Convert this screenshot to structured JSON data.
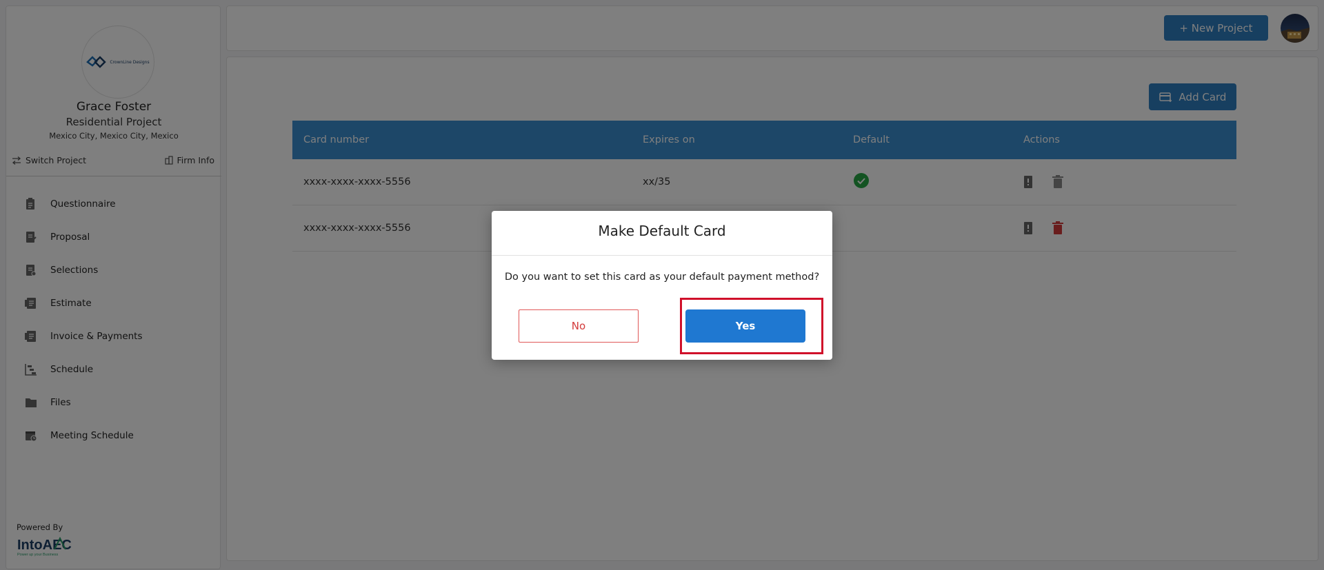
{
  "sidebar": {
    "logo_text": "CrownLine Designs",
    "client_name": "Grace Foster",
    "project_name": "Residential Project",
    "location": "Mexico City, Mexico City, Mexico",
    "switch_project": "Switch Project",
    "firm_info": "Firm Info",
    "items": [
      {
        "label": "Questionnaire",
        "icon": "questionnaire-icon"
      },
      {
        "label": "Proposal",
        "icon": "proposal-icon"
      },
      {
        "label": "Selections",
        "icon": "selections-icon"
      },
      {
        "label": "Estimate",
        "icon": "estimate-icon"
      },
      {
        "label": "Invoice & Payments",
        "icon": "invoice-icon"
      },
      {
        "label": "Schedule",
        "icon": "schedule-icon"
      },
      {
        "label": "Files",
        "icon": "folder-icon"
      },
      {
        "label": "Meeting Schedule",
        "icon": "calendar-icon"
      }
    ],
    "powered_by": "Powered By",
    "powered_logo": "IntoAEC",
    "powered_tagline": "Power up your Business"
  },
  "header": {
    "new_project_label": "+ New Project"
  },
  "main": {
    "add_card_label": "Add Card",
    "table": {
      "columns": [
        "Card number",
        "Expires on",
        "Default",
        "Actions"
      ],
      "rows": [
        {
          "card_number": "xxxx-xxxx-xxxx-5556",
          "expires": "xx/35",
          "is_default": true
        },
        {
          "card_number": "xxxx-xxxx-xxxx-5556",
          "expires": "",
          "is_default": false
        }
      ]
    }
  },
  "modal": {
    "title": "Make Default Card",
    "message": "Do you want to set this card as your default payment method?",
    "no_label": "No",
    "yes_label": "Yes"
  },
  "colors": {
    "primary": "#1f78d1",
    "table_header": "#3b8ed0",
    "danger": "#d33a3a",
    "success": "#27a745",
    "highlight": "#d0102a"
  }
}
